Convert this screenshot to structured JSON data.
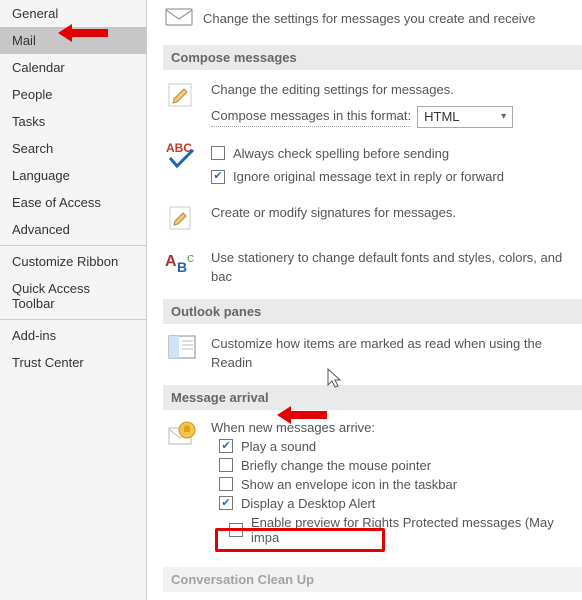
{
  "sidebar": {
    "items": [
      {
        "label": "General"
      },
      {
        "label": "Mail"
      },
      {
        "label": "Calendar"
      },
      {
        "label": "People"
      },
      {
        "label": "Tasks"
      },
      {
        "label": "Search"
      },
      {
        "label": "Language"
      },
      {
        "label": "Ease of Access"
      },
      {
        "label": "Advanced"
      },
      {
        "label": "Customize Ribbon"
      },
      {
        "label": "Quick Access Toolbar"
      },
      {
        "label": "Add-ins"
      },
      {
        "label": "Trust Center"
      }
    ]
  },
  "header": {
    "subtitle": "Change the settings for messages you create and receive"
  },
  "sections": {
    "compose": {
      "title": "Compose messages",
      "edit_text": "Change the editing settings for messages.",
      "compose_link": "Compose messages in this format:",
      "format_value": "HTML",
      "spell_always": "Always check spelling before sending",
      "spell_ignore": "Ignore original message text in reply or forward",
      "signatures": "Create or modify signatures for messages.",
      "stationery": "Use stationery to change default fonts and styles, colors, and bac"
    },
    "panes": {
      "title": "Outlook panes",
      "text": "Customize how items are marked as read when using the Readin"
    },
    "arrival": {
      "title": "Message arrival",
      "when": "When new messages arrive:",
      "play_sound": "Play a sound",
      "brief_pointer": "Briefly change the mouse pointer",
      "envelope_taskbar": "Show an envelope icon in the taskbar",
      "desktop_alert": "Display a Desktop Alert",
      "enable_preview": "Enable preview for Rights Protected messages (May impa"
    },
    "cleanup": {
      "title": "Conversation Clean Up"
    }
  }
}
